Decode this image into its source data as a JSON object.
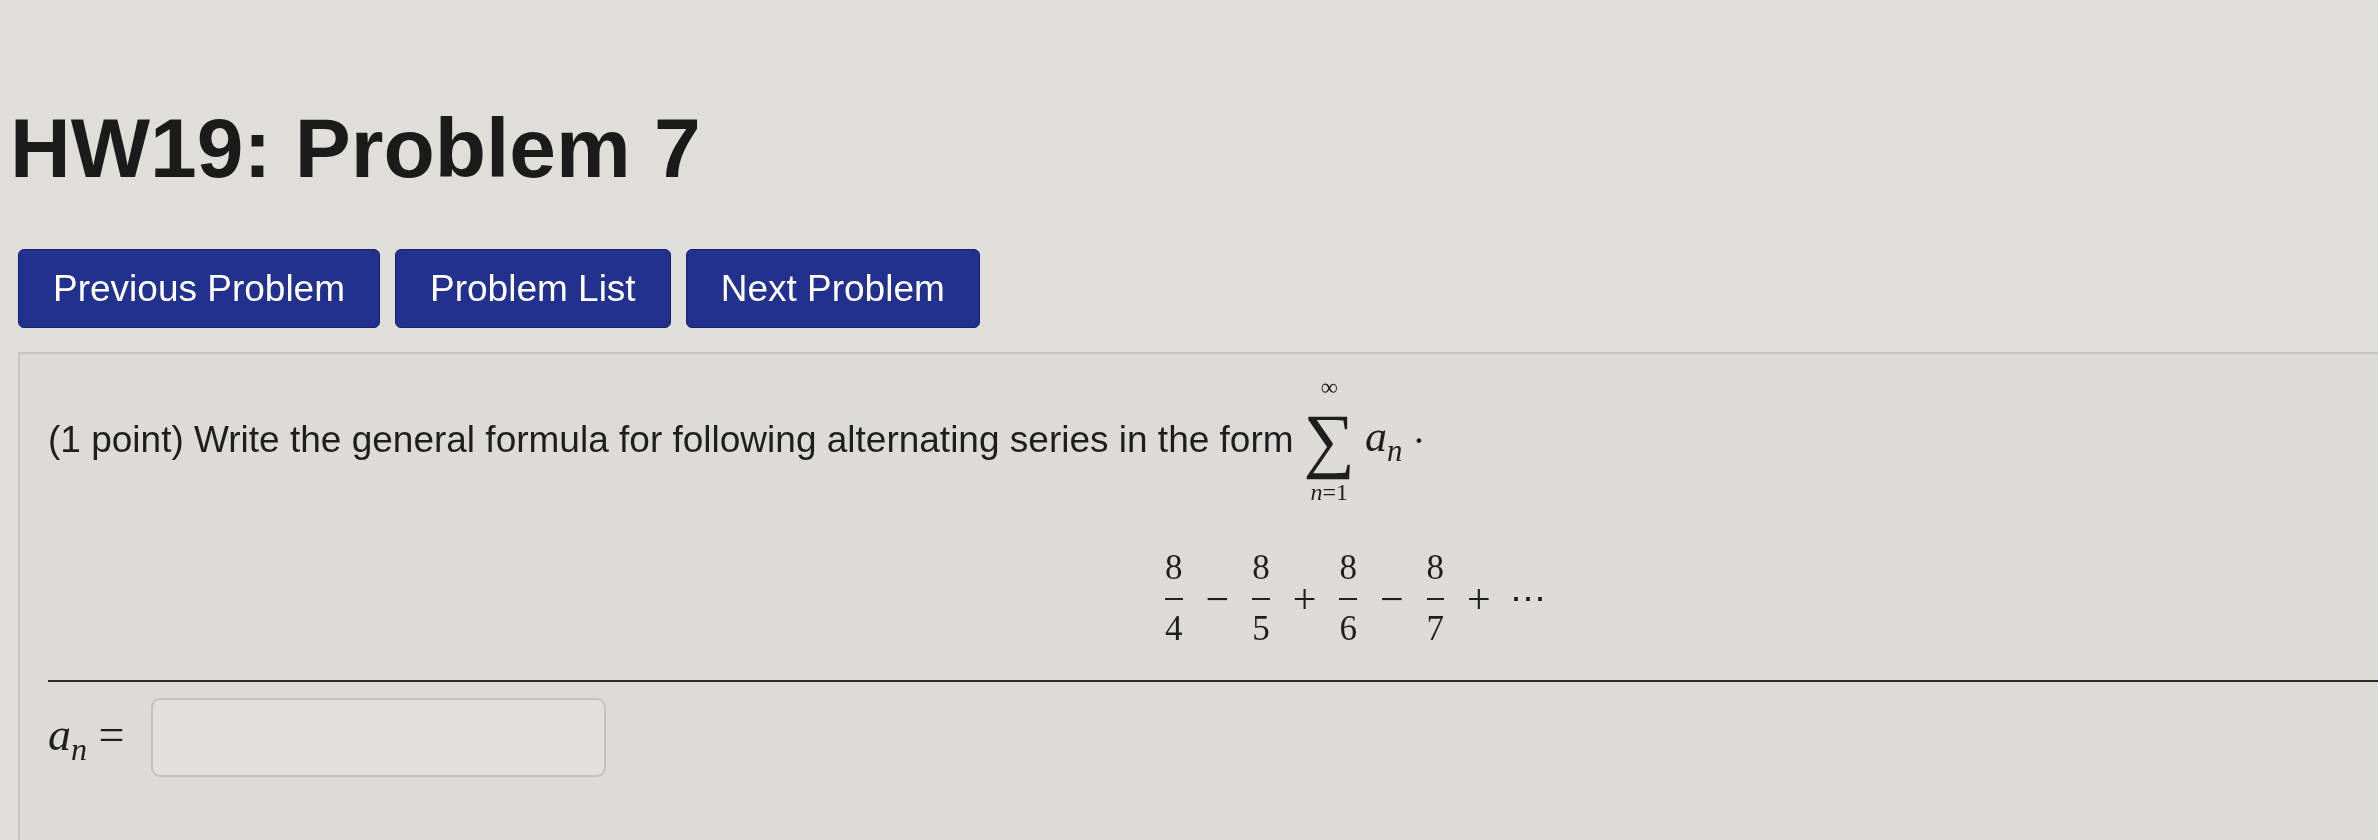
{
  "title": "HW19: Problem 7",
  "nav_buttons": [
    {
      "label": "Previous Problem"
    },
    {
      "label": "Problem List"
    },
    {
      "label": "Next Problem"
    }
  ],
  "problem": {
    "statement": "(1 point) Write the general formula for following alternating series in the form",
    "summation": {
      "symbol": "∑",
      "upper": "∞",
      "lower": "*n*=1",
      "term": "*a*$_{n}$",
      "end": "·"
    },
    "series": [
      {
        "kind": "fraction",
        "numerator": "8",
        "denominator": "4"
      },
      {
        "kind": "operator",
        "text": "−"
      },
      {
        "kind": "fraction",
        "numerator": "8",
        "denominator": "5"
      },
      {
        "kind": "operator",
        "text": "+"
      },
      {
        "kind": "fraction",
        "numerator": "8",
        "denominator": "6"
      },
      {
        "kind": "operator",
        "text": "−"
      },
      {
        "kind": "fraction",
        "numerator": "8",
        "denominator": "7"
      },
      {
        "kind": "operator",
        "text": "+"
      },
      {
        "kind": "ellipsis",
        "text": "⋯"
      }
    ],
    "answer": {
      "label": "*a*$_{n}$ ="
    }
  }
}
